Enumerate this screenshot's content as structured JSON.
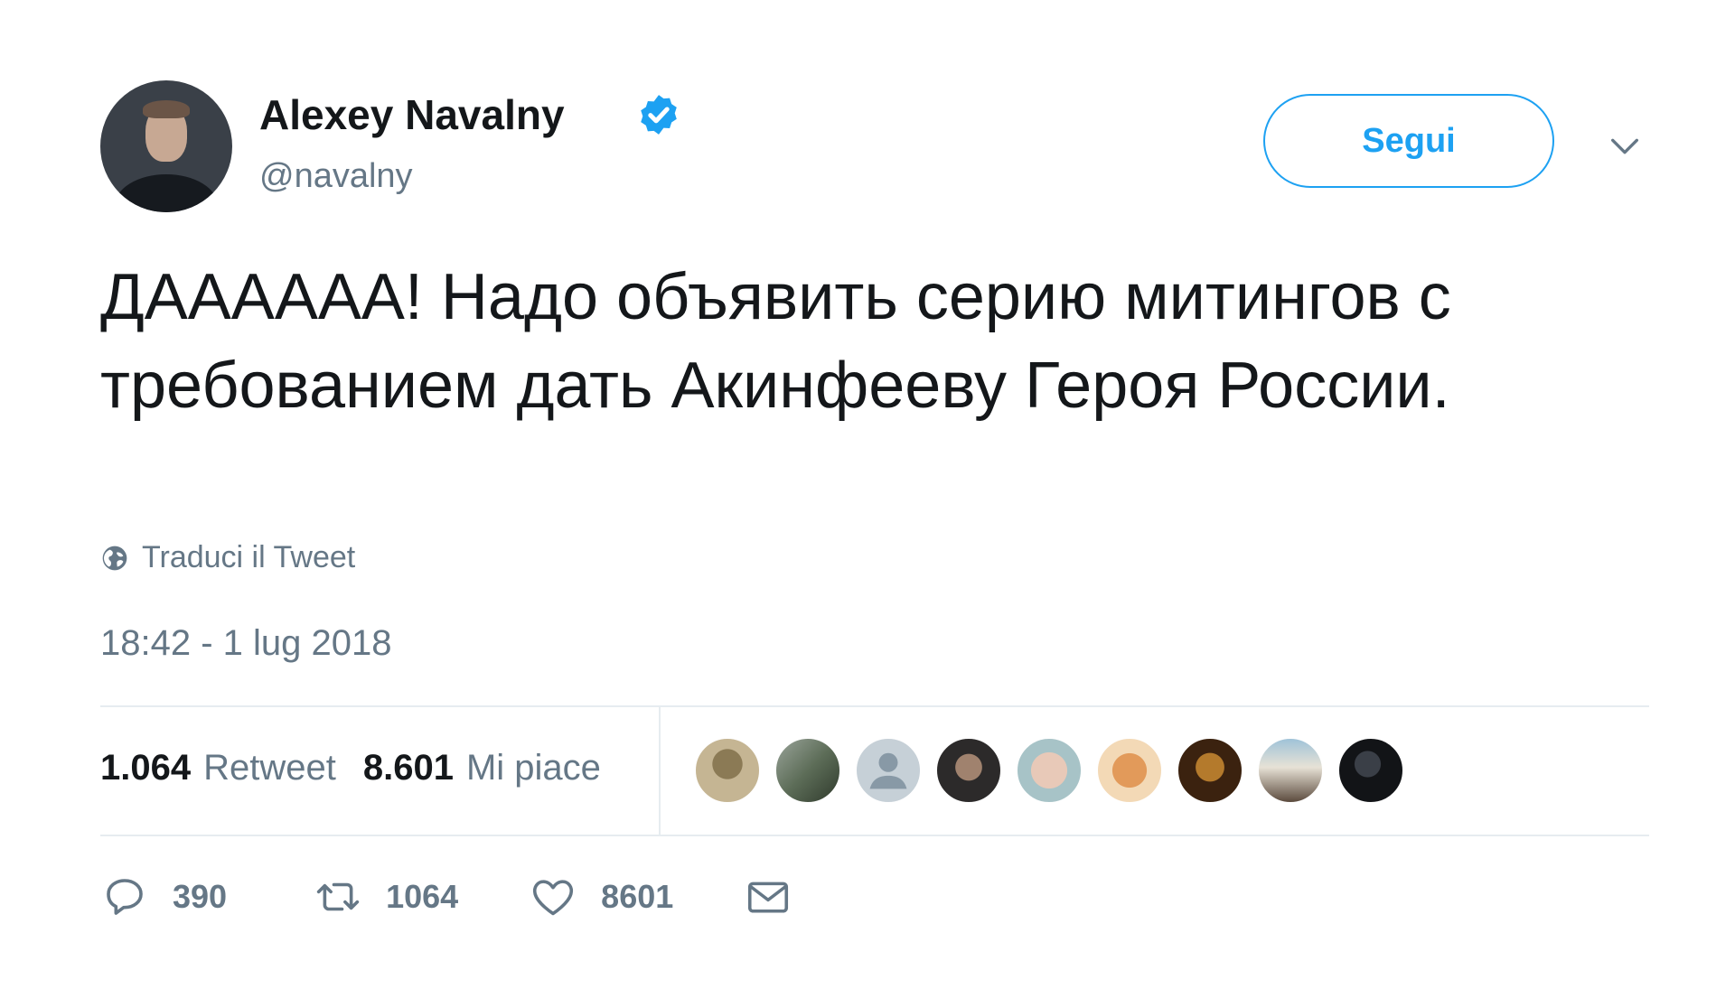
{
  "author": {
    "name": "Alexey Navalny",
    "handle": "@navalny",
    "verified": true
  },
  "follow_button": {
    "label": "Segui"
  },
  "tweet_text": "ДАААААА! Надо объявить серию митингов с требованием дать Акинфееву Героя России.",
  "translate_label": "Traduci il Tweet",
  "timestamp": "18:42 - 1 lug 2018",
  "stats": {
    "retweets_count": "1.064",
    "retweets_label": "Retweet",
    "likes_count": "8.601",
    "likes_label": "Mi piace"
  },
  "actions": {
    "reply_count": "390",
    "retweet_count": "1064",
    "like_count": "8601"
  },
  "icons": {
    "verified": "verified-badge-icon",
    "caret": "chevron-down-icon",
    "translate": "globe-icon",
    "reply": "reply-bubble-icon",
    "retweet": "retweet-icon",
    "like": "heart-icon",
    "dm": "envelope-icon"
  },
  "colors": {
    "accent": "#1da1f2",
    "secondary_text": "#657786",
    "primary_text": "#14171a",
    "divider": "#e6ecf0"
  }
}
